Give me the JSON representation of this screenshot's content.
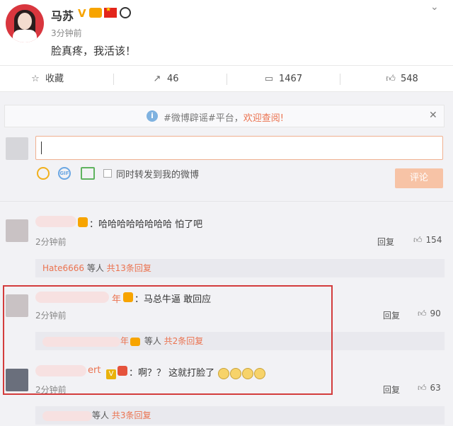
{
  "post": {
    "author": "马苏",
    "time": "3分钟前",
    "text": "脸真疼，我活该！",
    "expand_icon": "chevron-down-icon"
  },
  "actions": {
    "favorite_label": "收藏",
    "repost_count": "46",
    "comment_count": "1467",
    "like_count": "548"
  },
  "composer": {
    "notice_prefix": "#微博辟谣#平台，",
    "notice_link": "欢迎查阅!",
    "input_value": "",
    "repost_label": "同时转发到我的微博",
    "submit_label": "评论"
  },
  "comments": [
    {
      "text": "：哈哈哈哈哈哈哈哈 怕了吧",
      "time": "2分钟前",
      "reply_label": "回复",
      "likes": "154",
      "sub": {
        "name": "Hate6666",
        "mid": " 等人 ",
        "count": "共13条回复"
      }
    },
    {
      "name_suffix": "年",
      "text": "：马总牛逼 敢回应",
      "time": "2分钟前",
      "reply_label": "回复",
      "likes": "90",
      "sub": {
        "name_suffix": "年",
        "mid": " 等人 ",
        "count": "共2条回复"
      }
    },
    {
      "name_suffix": "ert",
      "text": "：啊？？ 这就打脸了",
      "time": "2分钟前",
      "reply_label": "回复",
      "likes": "63",
      "sub": {
        "mid": "等人 ",
        "count": "共3条回复"
      }
    }
  ],
  "colors": {
    "accent": "#eb7350",
    "highlight": "#d33c3c"
  }
}
